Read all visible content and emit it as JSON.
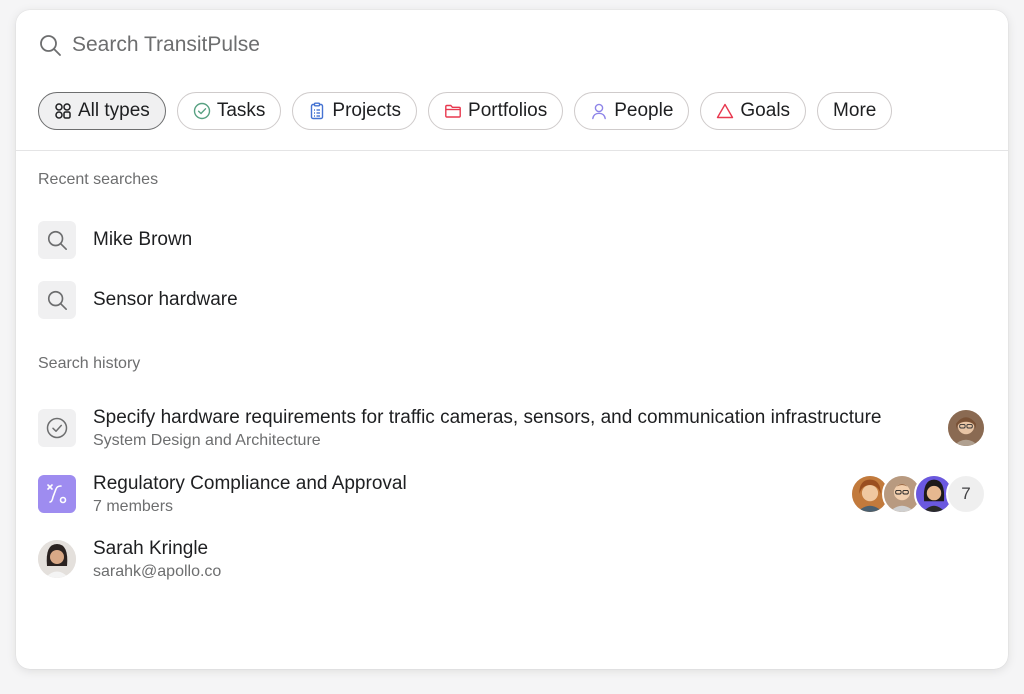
{
  "search": {
    "placeholder": "Search TransitPulse",
    "icon": "search-icon"
  },
  "filters": [
    {
      "label": "All types",
      "icon": "grid-icon",
      "active": true
    },
    {
      "label": "Tasks",
      "icon": "check-circle-icon",
      "color": "#58a182"
    },
    {
      "label": "Projects",
      "icon": "clipboard-icon",
      "color": "#4573d2"
    },
    {
      "label": "Portfolios",
      "icon": "folder-icon",
      "color": "#e8384f"
    },
    {
      "label": "People",
      "icon": "person-icon",
      "color": "#8d84e8"
    },
    {
      "label": "Goals",
      "icon": "triangle-icon",
      "color": "#e8384f"
    },
    {
      "label": "More"
    }
  ],
  "recent": {
    "heading": "Recent searches",
    "items": [
      {
        "label": "Mike Brown",
        "icon": "search-icon"
      },
      {
        "label": "Sensor hardware",
        "icon": "search-icon"
      }
    ]
  },
  "history": {
    "heading": "Search history",
    "items": [
      {
        "type": "task",
        "icon": "check-circle-icon",
        "title": "Specify hardware requirements for traffic cameras, sensors, and communication infrastructure",
        "subtitle": "System Design and Architecture"
      },
      {
        "type": "project",
        "icon": "project-icon",
        "title": "Regulatory Compliance and Approval",
        "subtitle": "7 members",
        "member_count": "7",
        "color": "#9e8cf0"
      },
      {
        "type": "person",
        "icon": "avatar",
        "title": "Sarah Kringle",
        "subtitle": "sarahk@apollo.co"
      }
    ]
  },
  "colors": {
    "text": "#1e1f21",
    "muted": "#6d6e6f",
    "chip_border": "#cfcbcb"
  }
}
